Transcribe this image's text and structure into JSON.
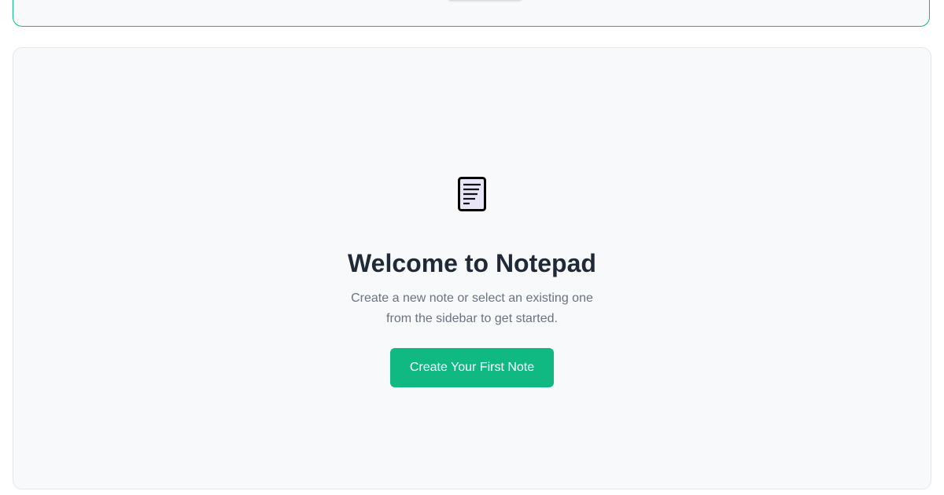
{
  "top_panel": {
    "tab_icon": "drag-handle-icon",
    "accent_color": "#10b981"
  },
  "empty_state": {
    "icon": "note-document-icon",
    "title": "Welcome to Notepad",
    "subtitle_line1": "Create a new note or select an existing one",
    "subtitle_line2": "from the sidebar to get started.",
    "button_label": "Create Your First Note",
    "button_color": "#10b981"
  }
}
